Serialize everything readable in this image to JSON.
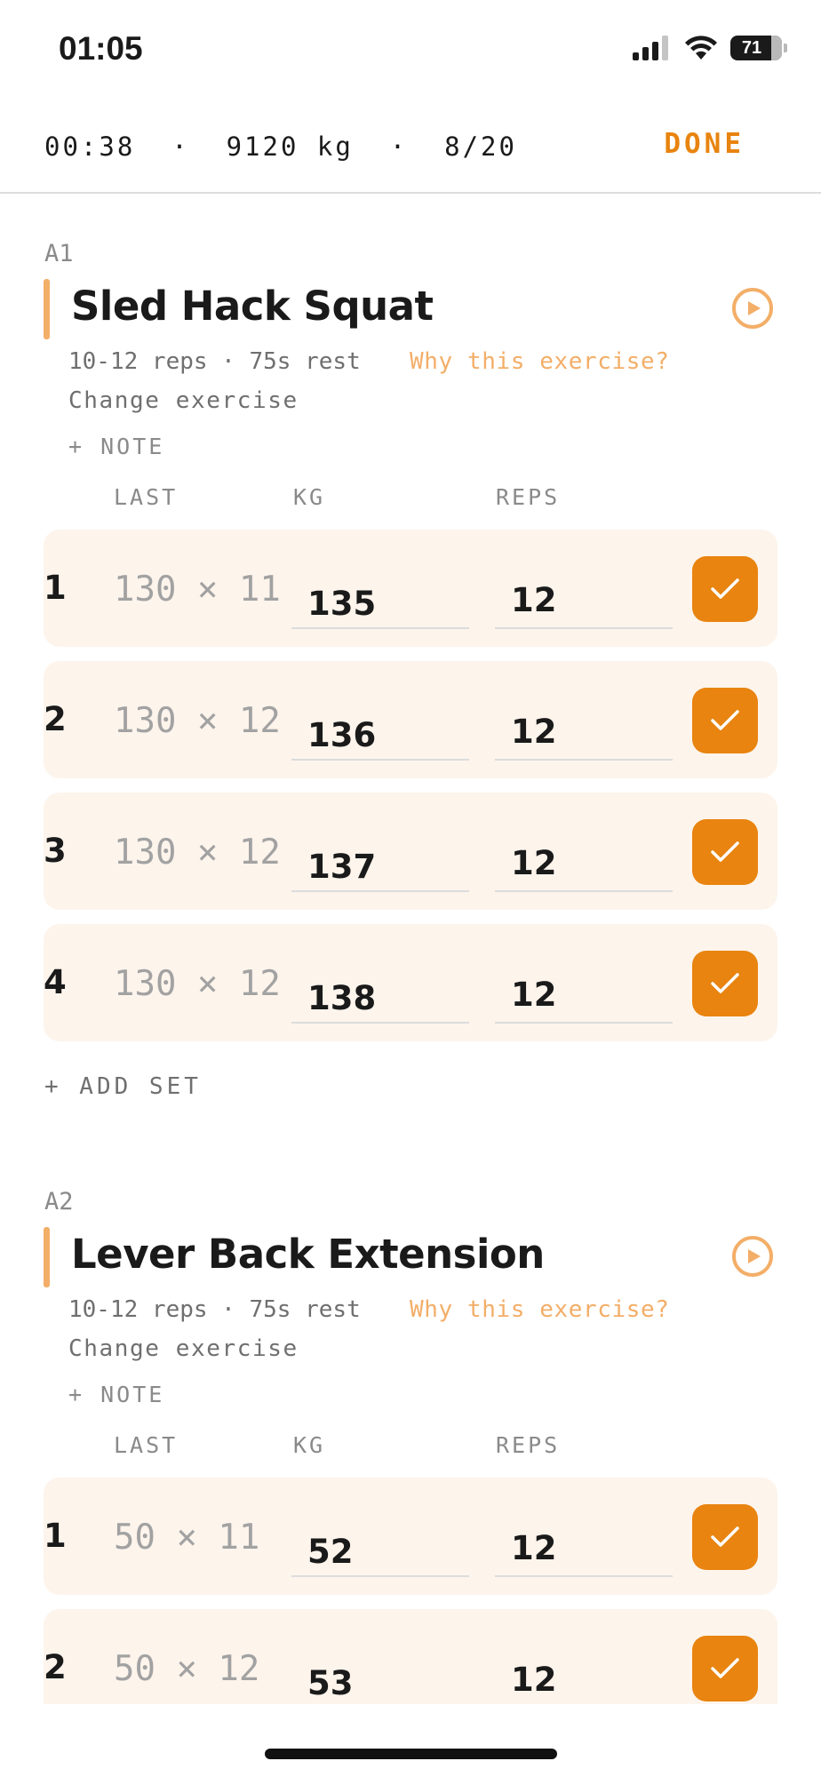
{
  "status_bar": {
    "time": "01:05",
    "battery": "71",
    "icons": [
      "cellular-signal-icon",
      "wifi-icon",
      "battery-icon"
    ]
  },
  "summary": {
    "text": "00:38  ·  9120 kg  ·  8/20",
    "done_label": "DONE"
  },
  "colors": {
    "accent": "#e8840f",
    "accent_light": "#f3ae68",
    "row_bg": "#fdf4ec"
  },
  "exercises": [
    {
      "code": "A1",
      "name": "Sled Hack Squat",
      "meta": "10-12 reps · 75s rest",
      "why_label": "Why this exercise?",
      "change_label": "Change exercise",
      "note_label": "+ NOTE",
      "columns": {
        "last": "LAST",
        "kg": "KG",
        "reps": "REPS"
      },
      "sets": [
        {
          "num": "1",
          "last": "130 × 11",
          "kg": "135",
          "reps": "12",
          "done": true
        },
        {
          "num": "2",
          "last": "130 × 12",
          "kg": "136",
          "reps": "12",
          "done": true
        },
        {
          "num": "3",
          "last": "130 × 12",
          "kg": "137",
          "reps": "12",
          "done": true
        },
        {
          "num": "4",
          "last": "130 × 12",
          "kg": "138",
          "reps": "12",
          "done": true
        }
      ],
      "add_set_label": "+ ADD SET"
    },
    {
      "code": "A2",
      "name": "Lever Back Extension",
      "meta": "10-12 reps · 75s rest",
      "why_label": "Why this exercise?",
      "change_label": "Change exercise",
      "note_label": "+ NOTE",
      "columns": {
        "last": "LAST",
        "kg": "KG",
        "reps": "REPS"
      },
      "sets": [
        {
          "num": "1",
          "last": "50 × 11",
          "kg": "52",
          "reps": "12",
          "done": true
        },
        {
          "num": "2",
          "last": "50 × 12",
          "kg": "53",
          "reps": "12",
          "done": true
        }
      ]
    }
  ]
}
